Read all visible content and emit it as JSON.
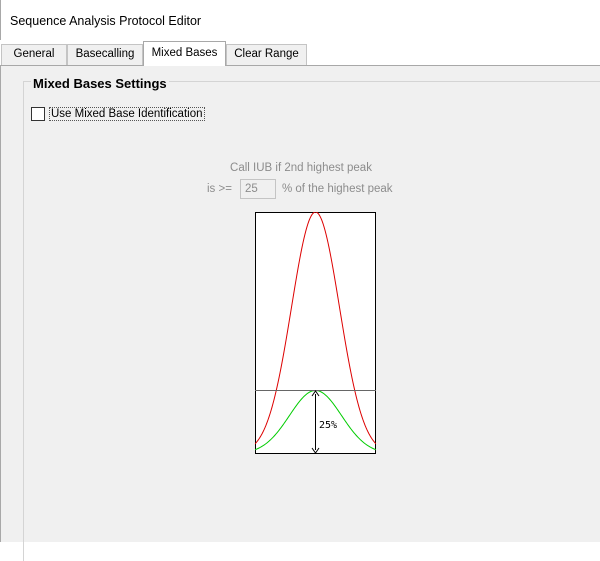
{
  "window": {
    "title": "Sequence Analysis Protocol Editor"
  },
  "tabs": [
    {
      "label": "General",
      "selected": false
    },
    {
      "label": "Basecalling",
      "selected": false
    },
    {
      "label": "Mixed Bases",
      "selected": true
    },
    {
      "label": "Clear Range",
      "selected": false
    }
  ],
  "mixed_bases": {
    "group_title": "Mixed Bases Settings",
    "use_mixed_base_checkbox": {
      "label": "Use Mixed Base Identification",
      "checked": false
    },
    "call_iub_text": "Call IUB if 2nd highest peak",
    "prefix": "is >=",
    "percent_value": "25",
    "suffix": "% of the highest peak",
    "diagram": {
      "percent_label": "25%",
      "highest_peak_color": "#dd0000",
      "second_peak_color": "#00cc00"
    }
  },
  "colors": {
    "panel_background": "#f0f0f0",
    "disabled_text": "#8c8c8c"
  }
}
